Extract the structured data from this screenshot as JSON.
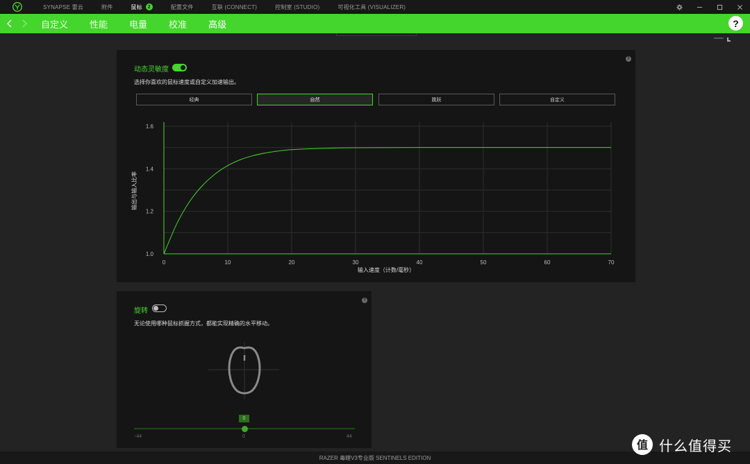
{
  "titlebar": {
    "tabs": [
      {
        "label": "SYNAPSE 雷云"
      },
      {
        "label": "附件"
      },
      {
        "label": "鼠标",
        "badge": "2",
        "active": true
      },
      {
        "label": "配置文件"
      },
      {
        "label": "互联 (CONNECT)"
      },
      {
        "label": "控制室 (STUDIO)"
      },
      {
        "label": "可视化工具 (VISUALIZER)"
      }
    ]
  },
  "navbar": {
    "subtabs": [
      {
        "label": "自定义"
      },
      {
        "label": "性能"
      },
      {
        "label": "电量"
      },
      {
        "label": "校准"
      },
      {
        "label": "高级",
        "active": true
      }
    ],
    "help": "?"
  },
  "accel_panel": {
    "title": "动态灵敏度",
    "toggle_on": true,
    "description": "选择你喜欢的鼠标速度或自定义加速输出。",
    "help": "?",
    "presets": [
      {
        "label": "经典"
      },
      {
        "label": "自然",
        "active": true
      },
      {
        "label": "跳跃"
      },
      {
        "label": "自定义"
      }
    ]
  },
  "chart_data": {
    "type": "line",
    "xlabel": "输入速度（计数/毫秒）",
    "ylabel": "输出与输入比率",
    "xlim": [
      0,
      70
    ],
    "ylim": [
      1.0,
      1.6
    ],
    "x_ticks": [
      "0",
      "10",
      "20",
      "30",
      "40",
      "50",
      "60",
      "70"
    ],
    "y_ticks": [
      "1.0",
      "1.2",
      "1.4",
      "1.6"
    ],
    "grid": true,
    "series": [
      {
        "color": "#44d62c",
        "x": [
          0,
          2,
          4,
          6,
          8,
          10,
          12,
          14,
          16,
          18,
          20,
          25,
          30,
          40,
          50,
          60,
          70
        ],
        "y": [
          1.0,
          1.14,
          1.245,
          1.32,
          1.375,
          1.415,
          1.443,
          1.462,
          1.475,
          1.484,
          1.49,
          1.496,
          1.499,
          1.5,
          1.5,
          1.5,
          1.5
        ]
      }
    ]
  },
  "rotation_panel": {
    "title": "旋转",
    "toggle_on": false,
    "description": "无论使用哪种鼠标抓握方式，都能实现精确的水平移动。",
    "help": "?",
    "slider": {
      "value": "0",
      "min_label": "-44",
      "mid_label": "0",
      "max_label": "44",
      "min": -44,
      "max": 44,
      "current": 0
    }
  },
  "footer": {
    "device": "RAZER 毒蝰V3专业版 SENTINELS EDITION"
  },
  "watermark": {
    "text": "什么值得买",
    "glyph": "值"
  },
  "colors": {
    "accent": "#44d62c",
    "bg": "#232323",
    "panel": "#151515"
  }
}
